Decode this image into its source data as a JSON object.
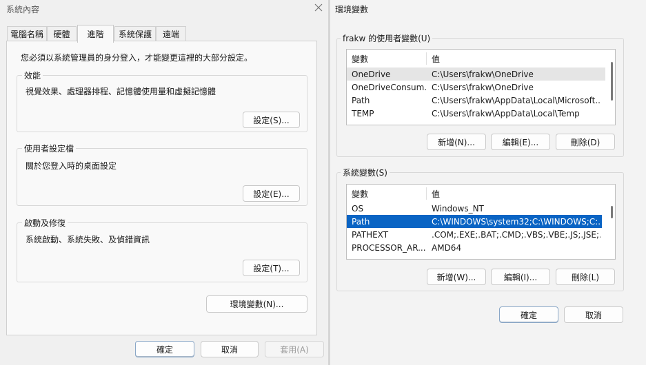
{
  "sys_props": {
    "title": "系統內容",
    "tabs": [
      "電腦名稱",
      "硬體",
      "進階",
      "系統保護",
      "遠端"
    ],
    "active_tab": "進階",
    "admin_note": "您必須以系統管理員的身分登入，才能變更這裡的大部分設定。",
    "performance": {
      "title": "效能",
      "desc": "視覺效果、處理器排程、記憶體使用量和虛擬記憶體",
      "button": "設定(S)..."
    },
    "user_profiles": {
      "title": "使用者設定檔",
      "desc": "關於您登入時的桌面設定",
      "button": "設定(E)..."
    },
    "startup": {
      "title": "啟動及修復",
      "desc": "系統啟動、系統失敗、及偵錯資訊",
      "button": "設定(T)..."
    },
    "env_button": "環境變數(N)...",
    "ok": "確定",
    "cancel": "取消",
    "apply": "套用(A)"
  },
  "env_vars": {
    "title": "環境變數",
    "user_group": {
      "title": "frakw 的使用者變數(U)",
      "headers": [
        "變數",
        "值"
      ],
      "rows": [
        {
          "name": "OneDrive",
          "value": "C:\\Users\\frakw\\OneDrive"
        },
        {
          "name": "OneDriveConsum...",
          "value": "C:\\Users\\frakw\\OneDrive"
        },
        {
          "name": "Path",
          "value": "C:\\Users\\frakw\\AppData\\Local\\Microsoft..."
        },
        {
          "name": "TEMP",
          "value": "C:\\Users\\frakw\\AppData\\Local\\Temp"
        }
      ],
      "new": "新增(N)...",
      "edit": "編輯(E)...",
      "delete": "刪除(D)"
    },
    "system_group": {
      "title": "系統變數(S)",
      "headers": [
        "變數",
        "值"
      ],
      "rows": [
        {
          "name": "OS",
          "value": "Windows_NT"
        },
        {
          "name": "Path",
          "value": "C:\\WINDOWS\\system32;C:\\WINDOWS;C:..."
        },
        {
          "name": "PATHEXT",
          "value": ".COM;.EXE;.BAT;.CMD;.VBS;.VBE;.JS;.JSE;..."
        },
        {
          "name": "PROCESSOR_AR...",
          "value": "AMD64"
        }
      ],
      "selected_row": "Path",
      "new": "新增(W)...",
      "edit": "編輯(I)...",
      "delete": "刪除(L)"
    },
    "ok": "確定",
    "cancel": "取消"
  },
  "icons": {
    "close": "close-icon"
  },
  "colors": {
    "selection": "#0a64c4",
    "window_bg": "#f0f0f0",
    "dialog_bg": "#f3f3f3"
  }
}
